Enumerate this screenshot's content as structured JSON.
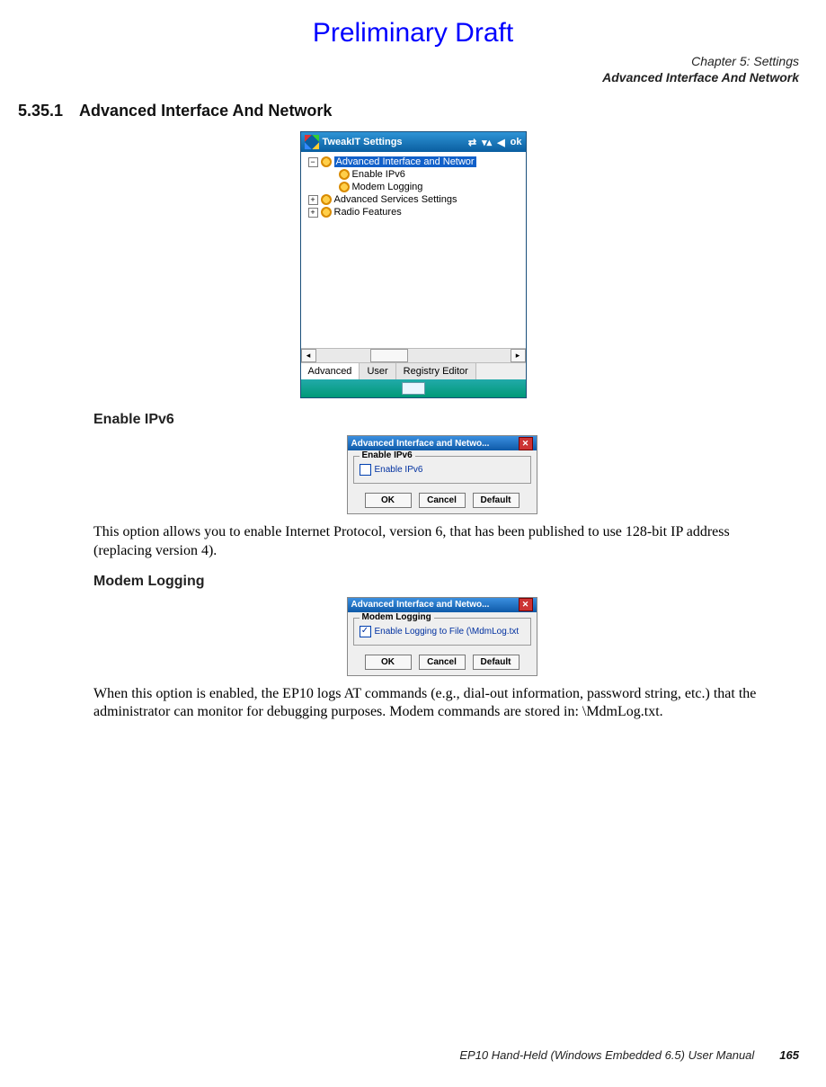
{
  "prelim": "Preliminary Draft",
  "chapter": {
    "line1": "Chapter 5:  Settings",
    "line2": "Advanced Interface And Network"
  },
  "section": {
    "number": "5.35.1",
    "title": "Advanced Interface And Network"
  },
  "fig1": {
    "title": "TweakIT Settings",
    "tray_ok": "ok",
    "tree": {
      "root_selected": "Advanced Interface and Networ",
      "child1": "Enable IPv6",
      "child2": "Modem Logging",
      "sibling1": "Advanced Services Settings",
      "sibling2": "Radio Features",
      "minus": "−",
      "plus1": "+",
      "plus2": "+"
    },
    "tabs": {
      "t1": "Advanced",
      "t2": "User",
      "t3": "Registry Editor"
    },
    "scroll_left": "◂",
    "scroll_right": "▸"
  },
  "sub1": {
    "heading": "Enable IPv6",
    "dlg_title": "Advanced Interface and Netwo...",
    "group_legend": "Enable IPv6",
    "chk_label": "Enable IPv6",
    "btn_ok": "OK",
    "btn_cancel": "Cancel",
    "btn_default": "Default",
    "para": "This option allows you to enable Internet Protocol, version 6, that has been published to use 128-bit IP address (replacing version 4)."
  },
  "sub2": {
    "heading": "Modem Logging",
    "dlg_title": "Advanced Interface and Netwo...",
    "group_legend": "Modem Logging",
    "chk_label": "Enable Logging to File (\\MdmLog.txt",
    "chk_mark": "✓",
    "btn_ok": "OK",
    "btn_cancel": "Cancel",
    "btn_default": "Default",
    "para": "When this option is enabled, the EP10 logs AT commands (e.g., dial-out information, password string, etc.) that the administrator can monitor for debugging purposes. Modem commands are stored in: \\MdmLog.txt."
  },
  "footer": {
    "manual": "EP10 Hand-Held (Windows Embedded 6.5) User Manual",
    "page": "165"
  }
}
